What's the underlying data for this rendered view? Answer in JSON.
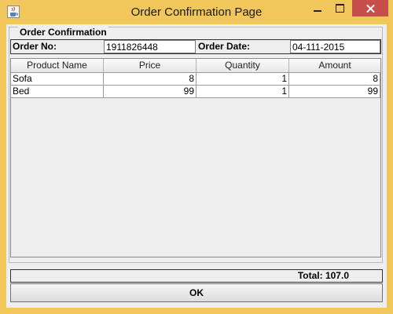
{
  "window": {
    "title": "Order Confirmation Page",
    "icon": "java-cup-icon",
    "controls": [
      "minimize-icon",
      "maximize-icon",
      "close-icon"
    ]
  },
  "panel": {
    "legend": "Order Confirmation"
  },
  "order": {
    "order_no_label": "Order No:",
    "order_no_value": "1911826448",
    "order_date_label": "Order Date:",
    "order_date_value": "04-111-2015"
  },
  "table": {
    "columns": [
      "Product Name",
      "Price",
      "Quantity",
      "Amount"
    ],
    "rows": [
      [
        "Sofa",
        "8",
        "1",
        "8"
      ],
      [
        "Bed",
        "99",
        "1",
        "99"
      ]
    ]
  },
  "summary": {
    "total_text": "Total: 107.0"
  },
  "actions": {
    "ok_label": "OK"
  },
  "colors": {
    "title_bar": "#f1c75c",
    "close_button": "#c74f4b",
    "client_bg": "#eeeeee"
  }
}
